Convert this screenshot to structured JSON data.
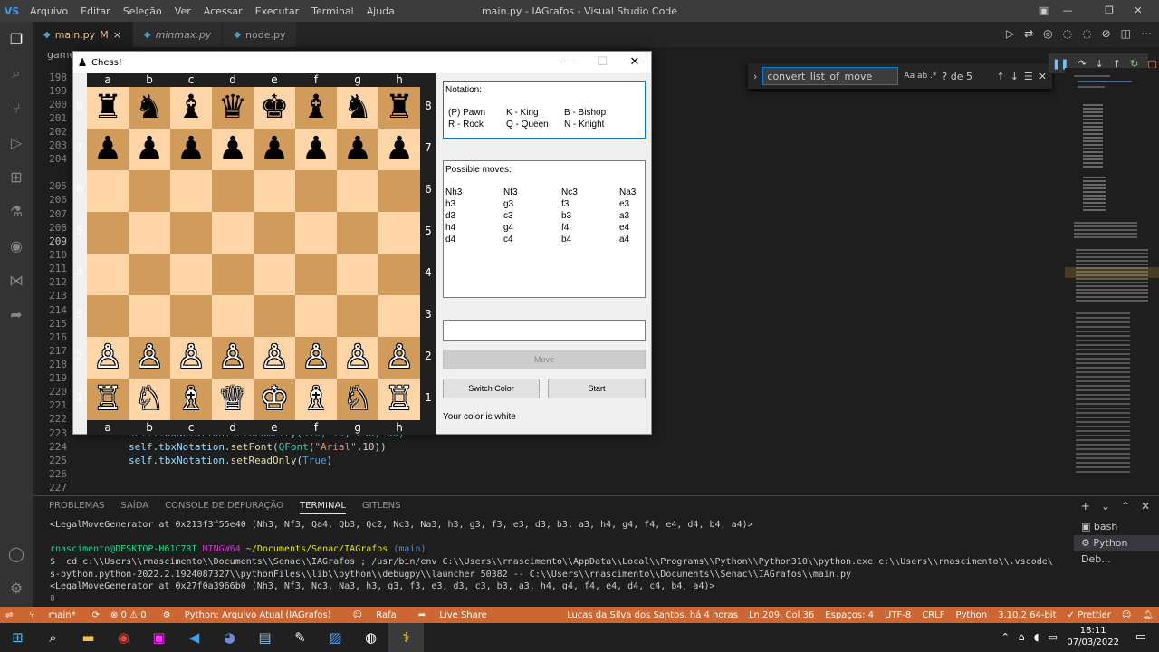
{
  "vscode": {
    "logo": "VS",
    "menu": [
      "Arquivo",
      "Editar",
      "Seleção",
      "Ver",
      "Acessar",
      "Executar",
      "Terminal",
      "Ajuda"
    ],
    "window_title": "main.py - IAGrafos - Visual Studio Code",
    "tabs": [
      {
        "label": "main.py",
        "badge": "M",
        "close": "×"
      },
      {
        "label": "minmax.py"
      },
      {
        "label": "node.py"
      }
    ],
    "breadcrumb": "games",
    "find": {
      "value": "convert_list_of_move",
      "opts": "Aa  ab  .*",
      "count": "? de 5"
    },
    "line_numbers": [
      "198",
      "199",
      "200",
      "201",
      "202",
      "203",
      "204",
      "205",
      "206",
      "207",
      "208",
      "209",
      "210",
      "211",
      "212",
      "213",
      "214",
      "215",
      "216",
      "217",
      "218",
      "219",
      "220",
      "221",
      "222",
      "223",
      "224",
      "225",
      "226",
      "227"
    ],
    "current_line": "209",
    "code": {
      "l223": "self.tbxNotation.setGeometry(510, 10, 230, 60)",
      "l224a": "self.tbxNotation.",
      "l224b": "setFont",
      "l224c": "(",
      "l224d": "QFont",
      "l224e": "(",
      "l224f": "\"Arial\"",
      "l224g": ",10))",
      "l225a": "self.tbxNotation.",
      "l225b": "setReadOnly",
      "l225c": "(",
      "l225d": "True",
      "l225e": ")"
    },
    "panel_tabs": [
      "PROBLEMAS",
      "SAÍDA",
      "CONSOLE DE DEPURAÇÃO",
      "TERMINAL",
      "GITLENS"
    ],
    "terminal": {
      "line1": "<LegalMoveGenerator at 0x213f3f55e40 (Nh3, Nf3, Qa4, Qb3, Qc2, Nc3, Na3, h3, g3, f3, e3, d3, b3, a3, h4, g4, f4, e4, d4, b4, a4)>",
      "prompt_user": "rnascimento@DESKTOP-H61C7RI",
      "prompt_env": "MINGW64",
      "prompt_path": "~/Documents/Senac/IAGrafos",
      "prompt_branch": "(main)",
      "cmd1": "$  cd c:\\\\Users\\\\rnascimento\\\\Documents\\\\Senac\\\\IAGrafos ; /usr/bin/env C:\\\\Users\\\\rnascimento\\\\AppData\\\\Local\\\\Programs\\\\Python\\\\Python310\\\\python.exe c:\\\\Users\\\\rnascimento\\\\.vscode\\\\extensions\\\\m",
      "cmd2": "s-python.python-2022.2.1924087327\\\\pythonFiles\\\\lib\\\\python\\\\debugpy\\\\launcher 50382 -- C:\\\\Users\\\\rnascimento\\\\Documents\\\\Senac\\\\IAGrafos\\\\main.py",
      "line3": "<LegalMoveGenerator at 0x27f0a3966b0 (Nh3, Nf3, Nc3, Na3, h3, g3, f3, e3, d3, c3, b3, a3, h4, g4, f4, e4, d4, c4, b4, a4)>",
      "cursor": "▯"
    },
    "terminal_list": [
      "bash",
      "Python Deb..."
    ],
    "status": {
      "branch": "main*",
      "sync": "⟳",
      "problems": "⊗ 0 ⚠ 0",
      "python": "Python: Arquivo Atual (IAGrafos)",
      "user": "Rafa",
      "liveshare": "Live Share",
      "blame": "Lucas da Silva dos Santos, há 4 horas",
      "position": "Ln 209, Col 36",
      "spaces": "Espaços: 4",
      "encoding": "UTF-8",
      "eol": "CRLF",
      "lang": "Python",
      "version": "3.10.2 64-bit",
      "prettier": "✓ Prettier"
    }
  },
  "chess": {
    "title": "Chess!",
    "files": [
      "a",
      "b",
      "c",
      "d",
      "e",
      "f",
      "g",
      "h"
    ],
    "ranks": [
      "8",
      "7",
      "6",
      "5",
      "4",
      "3",
      "2",
      "1"
    ],
    "board": [
      [
        "♜",
        "♞",
        "♝",
        "♛",
        "♚",
        "♝",
        "♞",
        "♜"
      ],
      [
        "♟",
        "♟",
        "♟",
        "♟",
        "♟",
        "♟",
        "♟",
        "♟"
      ],
      [
        "",
        "",
        "",
        "",
        "",
        "",
        "",
        ""
      ],
      [
        "",
        "",
        "",
        "",
        "",
        "",
        "",
        ""
      ],
      [
        "",
        "",
        "",
        "",
        "",
        "",
        "",
        ""
      ],
      [
        "",
        "",
        "",
        "",
        "",
        "",
        "",
        ""
      ],
      [
        "♙",
        "♙",
        "♙",
        "♙",
        "♙",
        "♙",
        "♙",
        "♙"
      ],
      [
        "♖",
        "♘",
        "♗",
        "♕",
        "♔",
        "♗",
        "♘",
        "♖"
      ]
    ],
    "notation": {
      "heading": "Notation:",
      "items": [
        "(P) Pawn",
        "K - King",
        "B - Bishop",
        "R - Rock",
        "Q - Queen",
        "N - Knight"
      ]
    },
    "moves": {
      "heading": "Possible moves:",
      "columns": [
        [
          "Nh3",
          "h3",
          "d3",
          "h4",
          "d4"
        ],
        [
          "Nf3",
          "g3",
          "c3",
          "g4",
          "c4"
        ],
        [
          "Nc3",
          "f3",
          "b3",
          "f4",
          "b4"
        ],
        [
          "Na3",
          "e3",
          "a3",
          "e4",
          "a4"
        ]
      ]
    },
    "move_input": "",
    "move_button": "Move",
    "switch_button": "Switch Color",
    "start_button": "Start",
    "color_label": "Your color is white"
  },
  "taskbar": {
    "time": "18:11",
    "date": "07/03/2022",
    "icons": [
      "windows-icon",
      "search-icon",
      "file-explorer-icon",
      "chrome-icon",
      "intellij-icon",
      "vscode-icon",
      "discord-icon",
      "notepad-icon",
      "paint-icon",
      "github-icon",
      "python-icon"
    ]
  }
}
